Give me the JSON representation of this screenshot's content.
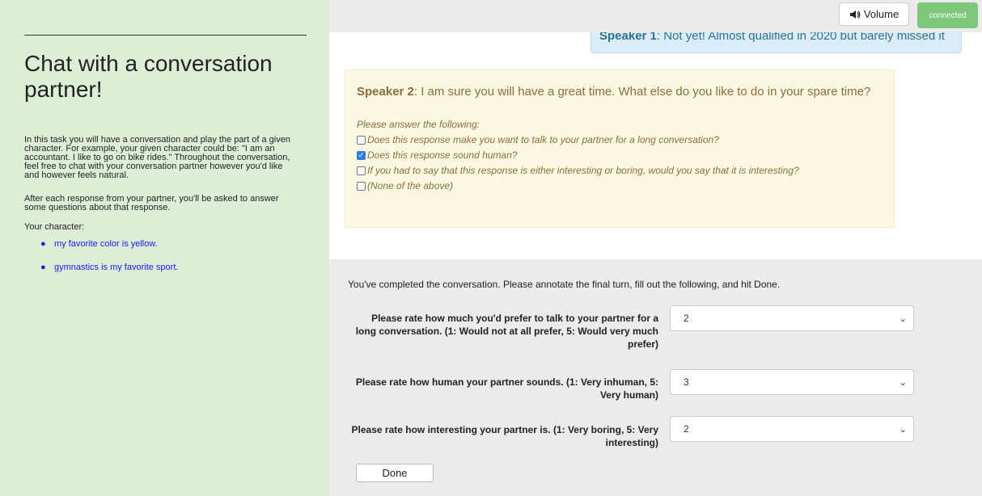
{
  "sidebar": {
    "title": "Chat with a conversation partner!",
    "intro": "In this task you will have a conversation and play the part of a given character. For example, your given character could be: \"I am an accountant. I like to go on bike rides.\" Throughout the conversation, feel free to chat with your conversation partner however you'd like and however feels natural.",
    "after": "After each response from your partner, you'll be asked to answer some questions about that response.",
    "character_label": "Your character:",
    "character_items": [
      "my favorite color is yellow.",
      "gymnastics is my favorite sport."
    ]
  },
  "header": {
    "volume_label": "Volume",
    "volume_icon": "speaker-icon",
    "status_label": "connected"
  },
  "chat": {
    "speaker1_name": "Speaker 1",
    "speaker1_text": ": Not yet! Almost qualified in 2020 but barely missed it",
    "speaker2_name": "Speaker 2",
    "speaker2_text": ": I am sure you will have a great time. What else do you like to do in your spare time?",
    "prompt": "Please answer the following:",
    "options": [
      {
        "label": "Does this response make you want to talk to your partner for a long conversation?",
        "checked": false
      },
      {
        "label": "Does this response sound human?",
        "checked": true
      },
      {
        "label": "If you had to say that this response is either interesting or boring, would you say that it is interesting?",
        "checked": false
      },
      {
        "label": "(None of the above)",
        "checked": false
      }
    ]
  },
  "final": {
    "message": "You've completed the conversation. Please annotate the final turn, fill out the following, and hit Done.",
    "questions": [
      {
        "label": "Please rate how much you'd prefer to talk to your partner for a long conversation. (1: Would not at all prefer, 5: Would very much prefer)",
        "value": "2"
      },
      {
        "label": "Please rate how human your partner sounds. (1: Very inhuman, 5: Very human)",
        "value": "3"
      },
      {
        "label": "Please rate how interesting your partner is. (1: Very boring, 5: Very interesting)",
        "value": "2"
      }
    ],
    "done_label": "Done"
  },
  "colors": {
    "sidebar_bg": "#dcefd6",
    "connected": "#7fc77b",
    "speaker1_bg": "#d9ecf7",
    "speaker2_bg": "#fcf8e3",
    "link": "#1a1aee"
  }
}
